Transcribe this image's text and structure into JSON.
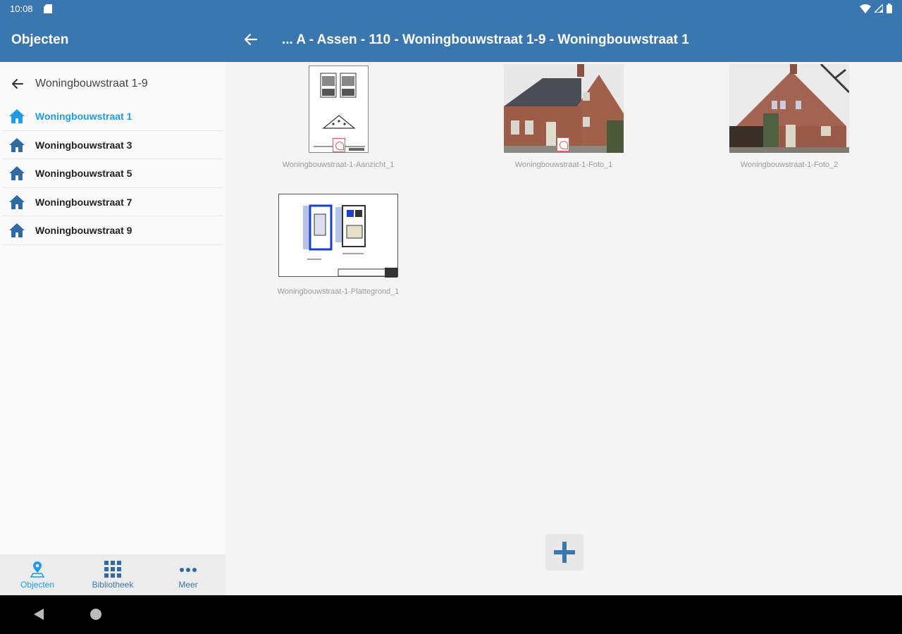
{
  "status": {
    "time": "10:08"
  },
  "appbar": {
    "left_title": "Objecten",
    "path_title": "... A - Assen - 110 - Woningbouwstraat 1-9 - Woningbouwstraat 1"
  },
  "sidebar": {
    "header_title": "Woningbouwstraat 1-9",
    "items": [
      {
        "label": "Woningbouwstraat 1"
      },
      {
        "label": "Woningbouwstraat 3"
      },
      {
        "label": "Woningbouwstraat 5"
      },
      {
        "label": "Woningbouwstraat 7"
      },
      {
        "label": "Woningbouwstraat 9"
      }
    ]
  },
  "bottomnav": {
    "items": [
      {
        "label": "Objecten"
      },
      {
        "label": "Bibliotheek"
      },
      {
        "label": "Meer"
      }
    ]
  },
  "files": [
    {
      "name": "Woningbouwstraat-1-Aanzicht_1"
    },
    {
      "name": "Woningbouwstraat-1-Foto_1"
    },
    {
      "name": "Woningbouwstraat-1-Foto_2"
    },
    {
      "name": "Woningbouwstraat-1-Plattegrond_1"
    }
  ],
  "colors": {
    "primary": "#3a77b0",
    "accent": "#1f9be8"
  },
  "icons": [
    "sd-card-icon",
    "wifi-icon",
    "signal-icon",
    "battery-icon",
    "back-arrow-icon",
    "house-icon",
    "pin-icon",
    "grid-icon",
    "more-icon",
    "pdf-icon",
    "plus-icon"
  ]
}
